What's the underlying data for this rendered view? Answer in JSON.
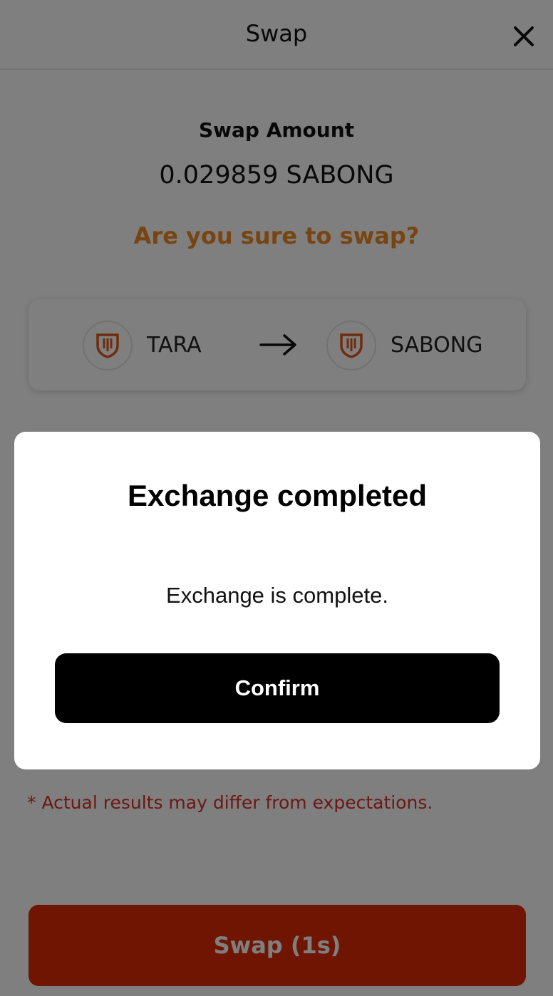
{
  "header": {
    "title": "Swap",
    "close_icon": "close-icon"
  },
  "swap": {
    "amount_label": "Swap Amount",
    "amount_value": "0.029859 SABONG",
    "question": "Are you sure to swap?",
    "from_token": {
      "name": "TARA",
      "icon": "shield-logo-icon"
    },
    "to_token": {
      "name": "SABONG",
      "icon": "shield-logo-icon"
    },
    "arrow_icon": "arrow-right-icon",
    "disclaimer": "* Actual results may differ from expectations.",
    "button_label": "Swap (1s)"
  },
  "modal": {
    "title": "Exchange completed",
    "message": "Exchange is complete.",
    "confirm_label": "Confirm"
  },
  "colors": {
    "accent_orange": "#f08a24",
    "swap_button": "#e02a05",
    "disclaimer_red": "#d9312b",
    "modal_button": "#000000",
    "overlay": "rgba(0,0,0,0.5)"
  }
}
